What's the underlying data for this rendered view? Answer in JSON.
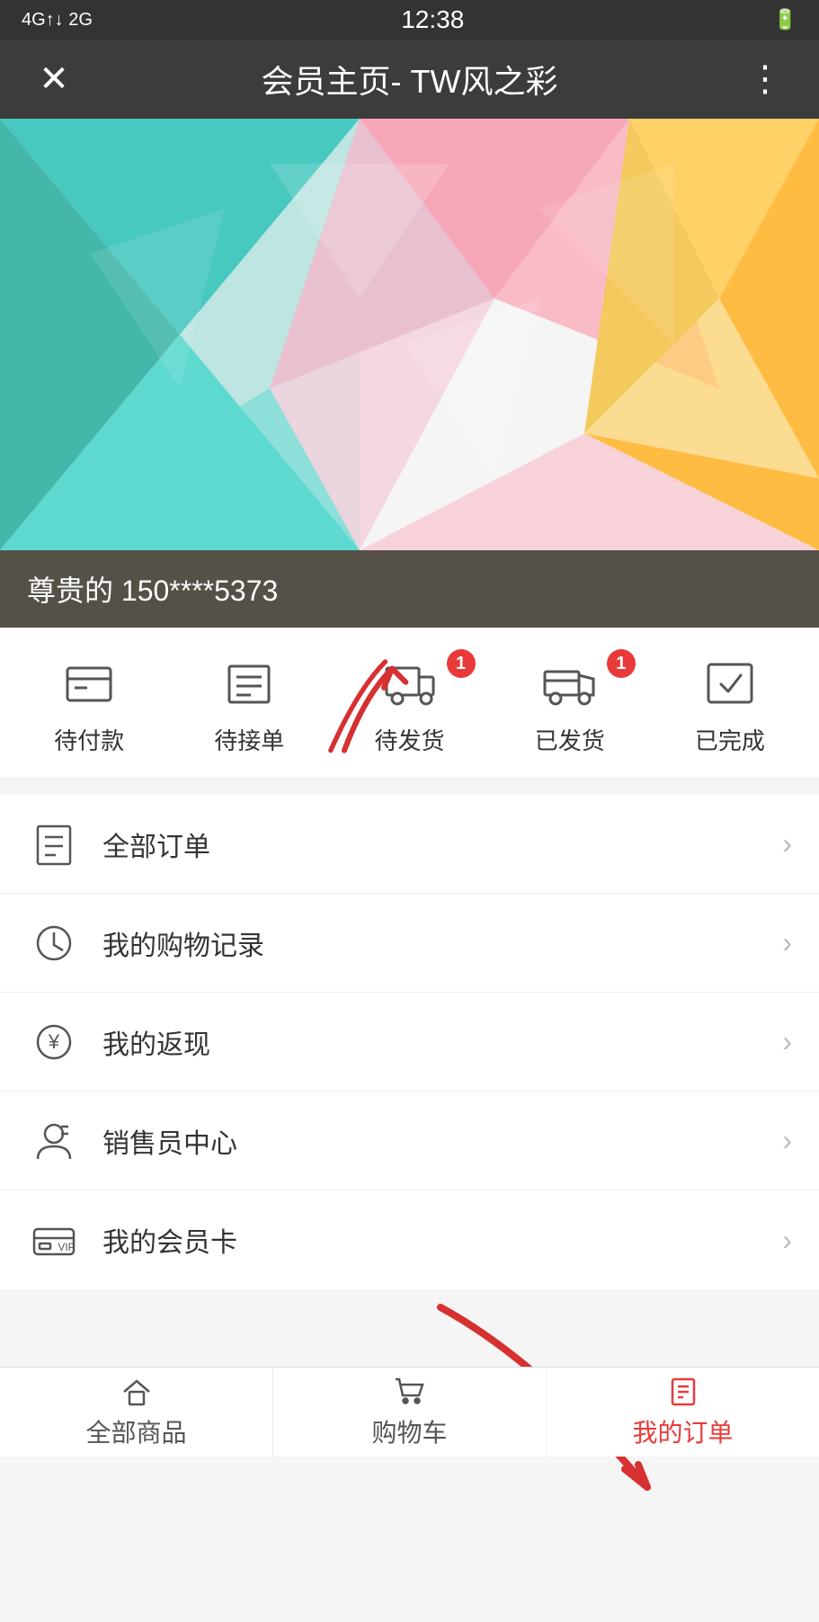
{
  "statusBar": {
    "signal": "4G 2G",
    "time": "12:38",
    "battery": "▮"
  },
  "topBar": {
    "closeIcon": "✕",
    "title": "会员主页- TW风之彩",
    "moreIcon": "⋮"
  },
  "hero": {
    "userText": "尊贵的 150****5373"
  },
  "orderStatus": {
    "items": [
      {
        "id": "pending-payment",
        "label": "待付款",
        "badge": null
      },
      {
        "id": "pending-accept",
        "label": "待接单",
        "badge": null
      },
      {
        "id": "pending-ship",
        "label": "待发货",
        "badge": "1"
      },
      {
        "id": "shipped",
        "label": "已发货",
        "badge": "1"
      },
      {
        "id": "completed",
        "label": "已完成",
        "badge": null
      }
    ]
  },
  "menuItems": [
    {
      "id": "all-orders",
      "label": "全部订单",
      "icon": "list"
    },
    {
      "id": "shopping-history",
      "label": "我的购物记录",
      "icon": "clock"
    },
    {
      "id": "cashback",
      "label": "我的返现",
      "icon": "yen"
    },
    {
      "id": "sales-center",
      "label": "销售员中心",
      "icon": "person"
    },
    {
      "id": "member-card",
      "label": "我的会员卡",
      "icon": "card"
    }
  ],
  "bottomNav": {
    "items": [
      {
        "id": "home",
        "label": "全部商品",
        "icon": "home"
      },
      {
        "id": "cart",
        "label": "购物车",
        "icon": "cart"
      },
      {
        "id": "my-orders",
        "label": "我的订单",
        "icon": "order",
        "active": true
      }
    ]
  }
}
